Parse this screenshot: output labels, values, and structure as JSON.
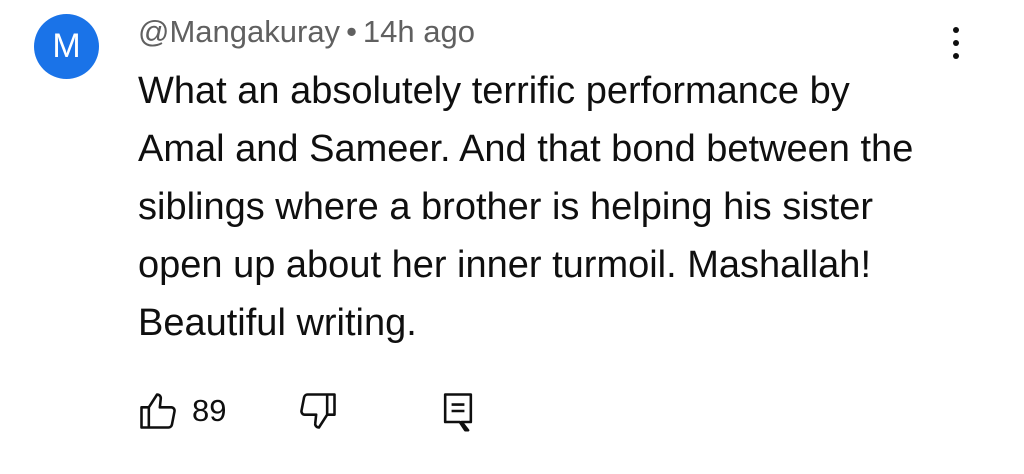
{
  "comment": {
    "avatar_letter": "M",
    "avatar_color": "#1a73e8",
    "author": "@Mangakuray",
    "separator": "•",
    "time": "14h ago",
    "lines": [
      "What an absolutely terrific performance by",
      "Amal and Sameer. And that bond between the",
      "siblings where a brother is helping his sister",
      "open up about her inner turmoil. Mashallah!",
      "Beautiful writing."
    ],
    "like_count": "89",
    "icons": {
      "more": "more-vertical-icon",
      "like": "thumbs-up-icon",
      "dislike": "thumbs-down-icon",
      "reply": "reply-comment-icon"
    }
  }
}
